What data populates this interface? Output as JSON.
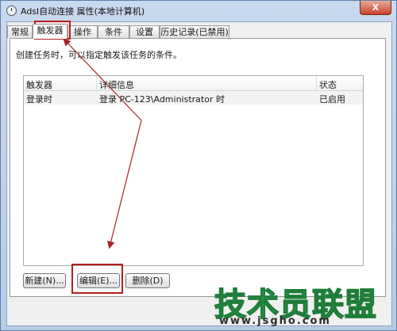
{
  "window": {
    "title": "Adsl自动连接 属性(本地计算机)",
    "close_label": "X"
  },
  "tabs": [
    {
      "label": "常规"
    },
    {
      "label": "触发器"
    },
    {
      "label": "操作"
    },
    {
      "label": "条件"
    },
    {
      "label": "设置"
    },
    {
      "label": "历史记录(已禁用)"
    }
  ],
  "active_tab": "触发器",
  "description": "创建任务时，可以指定触发该任务的条件。",
  "table": {
    "columns": [
      "触发器",
      "详细信息",
      "状态"
    ],
    "rows": [
      {
        "trigger": "登录时",
        "details": "登录 PC-123\\Administrator 时",
        "status": "已启用"
      }
    ]
  },
  "buttons": {
    "new": "新建(N)...",
    "edit": "编辑(E)...",
    "delete": "删除(D)"
  },
  "watermark": {
    "title": "技术员联盟",
    "url": "www.jsgho.com"
  },
  "colors": {
    "annotation": "#b81c1c",
    "watermark_green": "#34c15a"
  }
}
